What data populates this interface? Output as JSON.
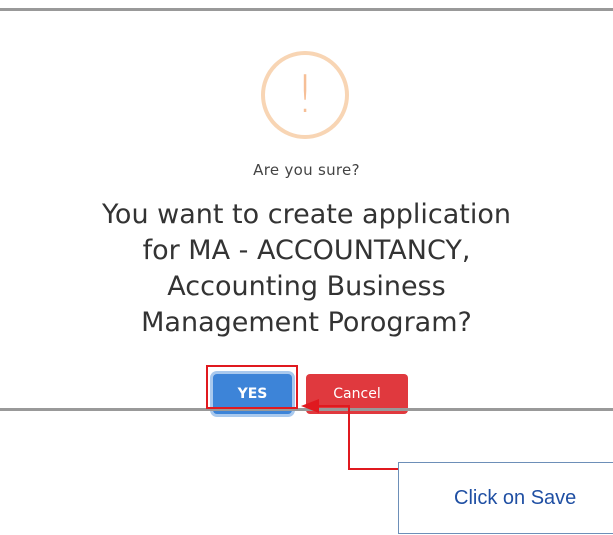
{
  "dialog": {
    "icon": "exclamation-icon",
    "icon_glyph": "!",
    "subtitle": "Are you sure?",
    "message_lines": [
      "You want to create application",
      "for MA - ACCOUNTANCY,",
      "Accounting Business",
      "Management Porogram?"
    ],
    "confirm_label": "YES",
    "cancel_label": "Cancel"
  },
  "annotation": {
    "callout_text": "Click on Save"
  },
  "colors": {
    "confirm": "#3d84d8",
    "cancel": "#e0393e",
    "warning_icon": "#f6bf97",
    "annotation": "#e0191f",
    "callout_text": "#1f4fa3",
    "divider": "#999999"
  }
}
